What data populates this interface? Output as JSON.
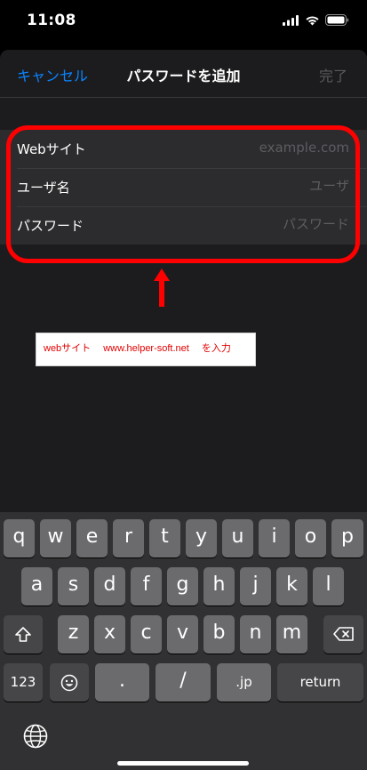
{
  "status": {
    "time": "11:08"
  },
  "nav": {
    "cancel": "キャンセル",
    "title": "パスワードを追加",
    "done": "完了"
  },
  "form": {
    "rows": [
      {
        "label": "Webサイト",
        "placeholder": "example.com"
      },
      {
        "label": "ユーザ名",
        "placeholder": "ユーザ"
      },
      {
        "label": "パスワード",
        "placeholder": "パスワード"
      }
    ]
  },
  "annotation": {
    "text": "webサイト　 www.helper-soft.net　 を入力"
  },
  "colors": {
    "accent": "#0a84ff",
    "highlight": "#ff0000",
    "sheet": "#1c1c1e"
  },
  "keyboard": {
    "row1": [
      "q",
      "w",
      "e",
      "r",
      "t",
      "y",
      "u",
      "i",
      "o",
      "p"
    ],
    "row2": [
      "a",
      "s",
      "d",
      "f",
      "g",
      "h",
      "j",
      "k",
      "l"
    ],
    "row3": [
      "z",
      "x",
      "c",
      "v",
      "b",
      "n",
      "m"
    ],
    "shift_icon": "shift-icon",
    "delete_icon": "delete-icon",
    "numbers": "123",
    "emoji_icon": "emoji-icon",
    "period": ".",
    "slash": "/",
    "jp": ".jp",
    "return": "return",
    "globe_icon": "globe-icon"
  }
}
